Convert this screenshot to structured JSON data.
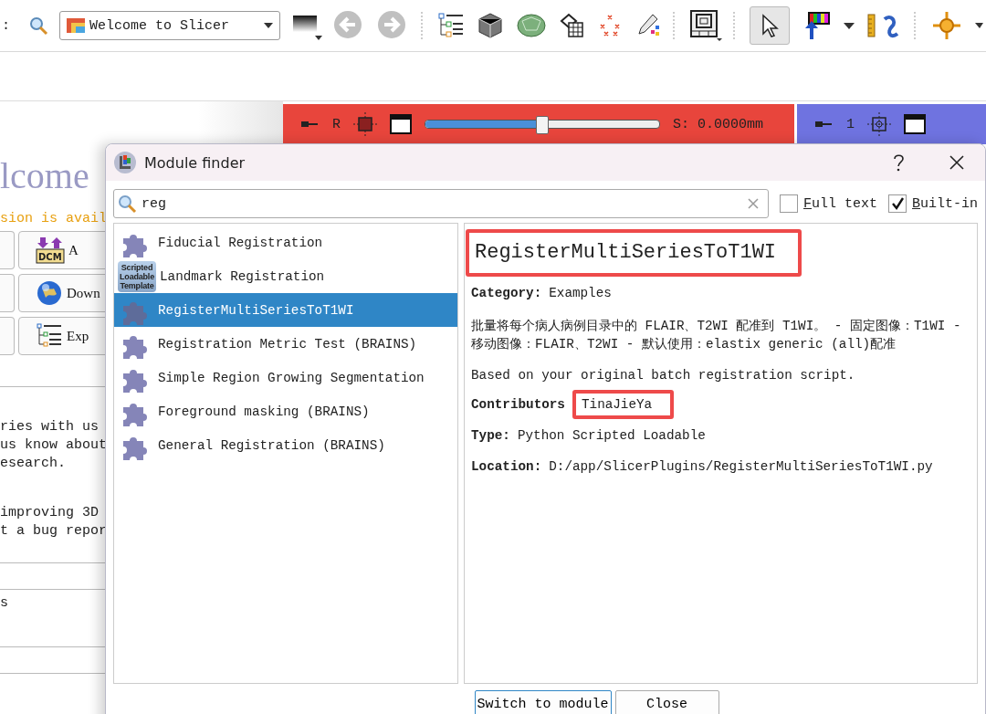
{
  "toolbar": {
    "label": ":",
    "module_selector": "Welcome to Slicer"
  },
  "background": {
    "heading": "lcome",
    "notice": "sion is avail",
    "buttons": [
      {
        "label": "A",
        "kind": "dicom",
        "icon_text": "DCM"
      },
      {
        "label": "Down",
        "kind": "globe"
      },
      {
        "label": "Exp",
        "kind": "tree"
      }
    ],
    "paragraphs": [
      [
        "ries with us",
        "us know about",
        "esearch."
      ],
      [
        "improving 3D",
        "t a bug repor"
      ]
    ],
    "rows": [
      "s"
    ]
  },
  "views": [
    {
      "color": "#e8453c",
      "label": "R",
      "reading": "S: 0.0000mm",
      "level": 0.5
    },
    {
      "color": "#6f73e0",
      "label": "1"
    }
  ],
  "dialog": {
    "title": "Module finder",
    "search": {
      "value": "reg"
    },
    "options": [
      {
        "label": "Full text",
        "checked": false
      },
      {
        "label": "Built-in",
        "checked": true
      }
    ],
    "modules": [
      {
        "name": "Fiducial Registration",
        "kind": "puzzle",
        "selected": false
      },
      {
        "name": "Landmark Registration",
        "kind": "template",
        "icon_text": "Scripted Loadable Template",
        "selected": false
      },
      {
        "name": "RegisterMultiSeriesToT1WI",
        "kind": "puzzle",
        "selected": true
      },
      {
        "name": "Registration Metric Test (BRAINS)",
        "kind": "puzzle",
        "selected": false
      },
      {
        "name": "Simple Region Growing Segmentation",
        "kind": "puzzle",
        "selected": false
      },
      {
        "name": "Foreground masking (BRAINS)",
        "kind": "puzzle",
        "selected": false
      },
      {
        "name": "General Registration (BRAINS)",
        "kind": "puzzle",
        "selected": false
      }
    ],
    "details": {
      "title": "RegisterMultiSeriesToT1WI",
      "title_highlighted": true,
      "sections": [
        {
          "kind": "field",
          "label": "Category:",
          "value": "Examples"
        },
        {
          "kind": "text",
          "text": "批量将每个病人病例目录中的 FLAIR、T2WI 配准到 T1WI。 - 固定图像：T1WI - 移动图像：FLAIR、T2WI - 默认使用：elastix generic (all)配准"
        },
        {
          "kind": "text",
          "text": "Based on your original batch registration script."
        },
        {
          "kind": "field",
          "label": "Contributors",
          "value": "TinaJieYa",
          "highlighted": true
        },
        {
          "kind": "field",
          "label": "Type:",
          "value": "Python Scripted Loadable"
        },
        {
          "kind": "field",
          "label": "Location:",
          "value": "D:/app/SlicerPlugins/RegisterMultiSeriesToT1WI.py"
        }
      ]
    },
    "buttons": [
      "Switch to module",
      "Close"
    ]
  }
}
